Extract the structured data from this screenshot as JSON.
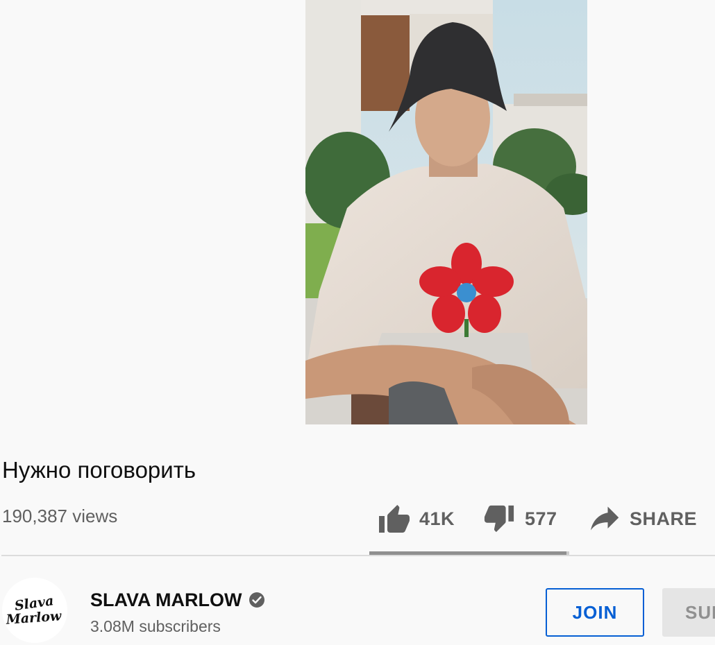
{
  "video": {
    "title": "Нужно поговорить",
    "views": "190,387 views"
  },
  "actions": {
    "like_count": "41K",
    "dislike_count": "577",
    "share_label": "SHARE",
    "like_ratio": 0.986
  },
  "channel": {
    "name": "SLAVA MARLOW",
    "subscribers": "3.08M subscribers",
    "avatar_text": "Slava Marlow",
    "join_label": "JOIN",
    "subscribe_label": "SUBSCRIBE"
  },
  "icons": {
    "like": "thumbs-up-icon",
    "dislike": "thumbs-down-icon",
    "share": "share-arrow-icon",
    "verified": "verified-check-icon"
  },
  "colors": {
    "accent": "#065fd4",
    "secondary_text": "#606060",
    "background": "#f9f9f9"
  }
}
